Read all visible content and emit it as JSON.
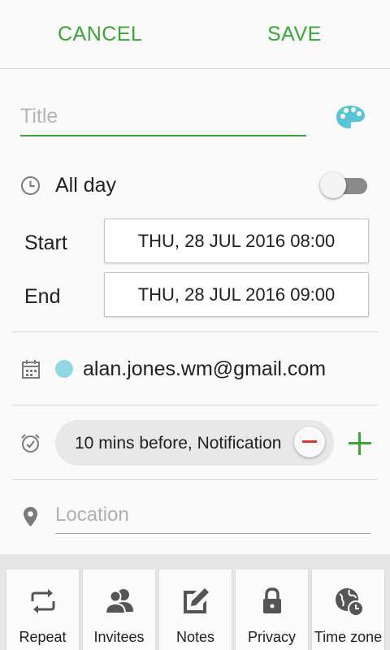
{
  "header": {
    "cancel_label": "CANCEL",
    "save_label": "SAVE"
  },
  "title_field": {
    "placeholder": "Title",
    "value": ""
  },
  "all_day": {
    "label": "All day",
    "enabled": false
  },
  "start": {
    "label": "Start",
    "value": "THU, 28 JUL 2016  08:00"
  },
  "end": {
    "label": "End",
    "value": "THU, 28 JUL 2016  09:00"
  },
  "calendar": {
    "account": "alan.jones.wm@gmail.com",
    "color": "#8fd8e3"
  },
  "reminder": {
    "text": "10 mins before, Notification"
  },
  "location_field": {
    "placeholder": "Location",
    "value": ""
  },
  "toolbar": {
    "repeat_label": "Repeat",
    "invitees_label": "Invitees",
    "notes_label": "Notes",
    "privacy_label": "Privacy",
    "timezone_label": "Time zone"
  },
  "colors": {
    "accent": "#3aa63a",
    "remove": "#dd3333",
    "icon": "#7a7a7a"
  },
  "icons": [
    "palette-icon",
    "clock-icon",
    "calendar-icon",
    "alarm-icon",
    "location-icon",
    "repeat-icon",
    "invitees-icon",
    "notes-icon",
    "lock-icon",
    "globe-clock-icon"
  ]
}
